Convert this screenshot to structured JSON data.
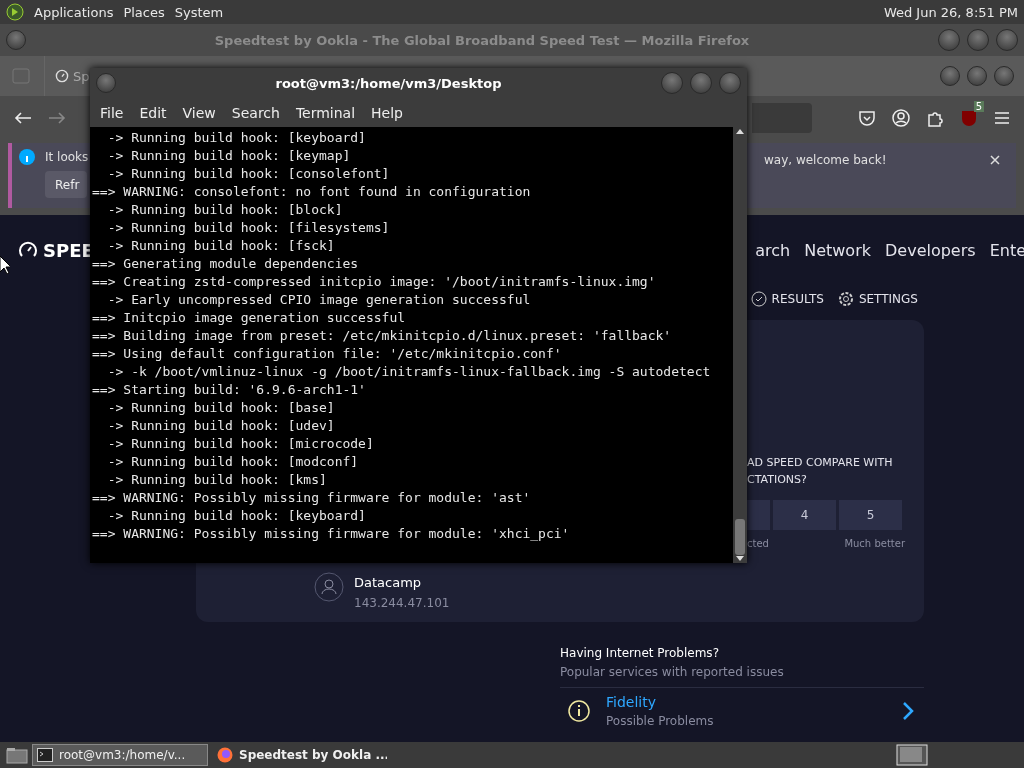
{
  "top_panel": {
    "menus": [
      "Applications",
      "Places",
      "System"
    ],
    "clock": "Wed Jun 26,  8:51 PM"
  },
  "browser": {
    "title": "Speedtest by Ookla - The Global Broadband Speed Test — Mozilla Firefox",
    "tab": {
      "label": "Sp"
    },
    "toolbar_badge": "5",
    "notification": {
      "text_start": "It looks",
      "text_end": "way, welcome back!",
      "button": "Refr"
    }
  },
  "speedtest": {
    "logo": "SPEE",
    "nav": [
      "arch",
      "Network",
      "Developers",
      "Ente"
    ],
    "actions": [
      {
        "kind": "results",
        "label": "RESULTS"
      },
      {
        "kind": "settings",
        "label": "SETTINGS"
      }
    ],
    "question": [
      "AD SPEED COMPARE WITH",
      "CTATIONS?"
    ],
    "ratings": [
      "4",
      "5"
    ],
    "rating_labels": [
      "cted",
      "Much better"
    ],
    "server": {
      "name": "Datacamp",
      "ip": "143.244.47.101"
    },
    "problems": {
      "title": "Having Internet Problems?",
      "subtitle": "Popular services with reported issues",
      "items": [
        {
          "name": "Fidelity",
          "status": "Possible Problems"
        }
      ]
    }
  },
  "terminal": {
    "title": "root@vm3:/home/vm3/Desktop",
    "menus": [
      "File",
      "Edit",
      "View",
      "Search",
      "Terminal",
      "Help"
    ],
    "lines": [
      "  -> Running build hook: [keyboard]",
      "  -> Running build hook: [keymap]",
      "  -> Running build hook: [consolefont]",
      "==> WARNING: consolefont: no font found in configuration",
      "  -> Running build hook: [block]",
      "  -> Running build hook: [filesystems]",
      "  -> Running build hook: [fsck]",
      "==> Generating module dependencies",
      "==> Creating zstd-compressed initcpio image: '/boot/initramfs-linux.img'",
      "  -> Early uncompressed CPIO image generation successful",
      "==> Initcpio image generation successful",
      "==> Building image from preset: /etc/mkinitcpio.d/linux.preset: 'fallback'",
      "==> Using default configuration file: '/etc/mkinitcpio.conf'",
      "  -> -k /boot/vmlinuz-linux -g /boot/initramfs-linux-fallback.img -S autodetect",
      "==> Starting build: '6.9.6-arch1-1'",
      "  -> Running build hook: [base]",
      "  -> Running build hook: [udev]",
      "  -> Running build hook: [microcode]",
      "  -> Running build hook: [modconf]",
      "  -> Running build hook: [kms]",
      "==> WARNING: Possibly missing firmware for module: 'ast'",
      "  -> Running build hook: [keyboard]",
      "==> WARNING: Possibly missing firmware for module: 'xhci_pci'"
    ]
  },
  "taskbar": {
    "items": [
      {
        "kind": "terminal",
        "label": "root@vm3:/home/v...",
        "selected": true
      },
      {
        "kind": "firefox",
        "label": "Speedtest by Ookla ...",
        "selected": false
      }
    ]
  }
}
